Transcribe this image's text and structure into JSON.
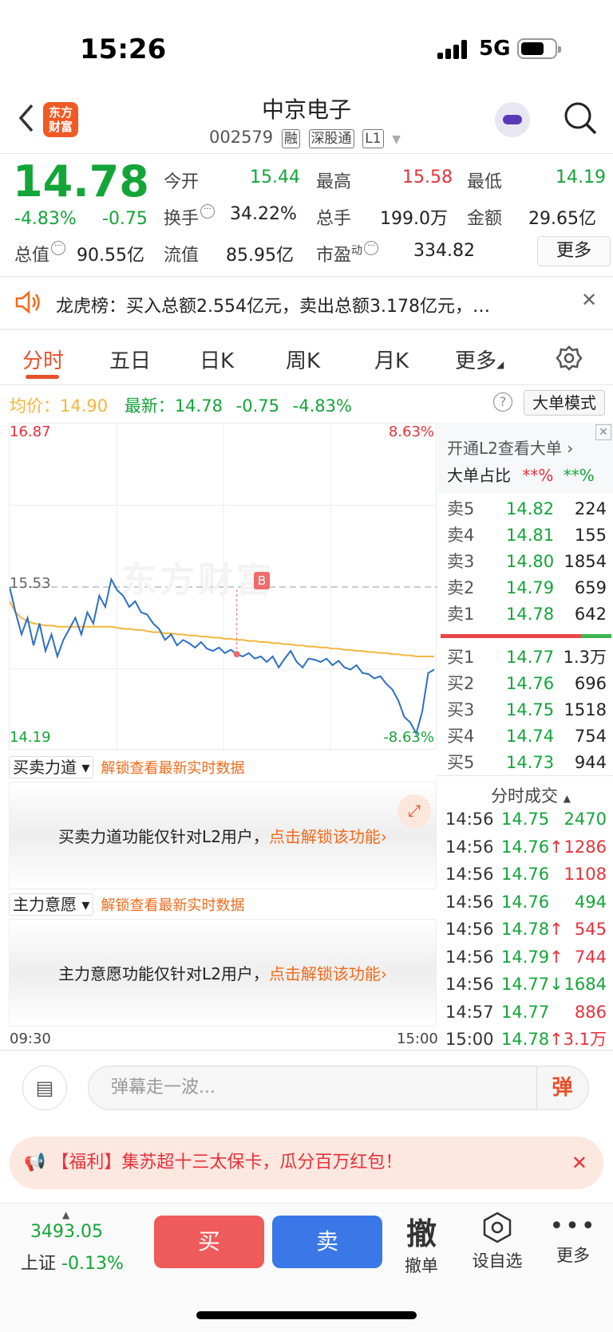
{
  "status": {
    "time": "15:26",
    "network": "5G"
  },
  "header": {
    "logo_text": "东方财富",
    "title": "中京电子",
    "code": "002579",
    "tags": [
      "融",
      "深股通",
      "L1"
    ]
  },
  "quote": {
    "price": "14.78",
    "change_pct": "-4.83%",
    "change": "-0.75",
    "fields": [
      {
        "label": "今开",
        "value": "15.44",
        "color": "green"
      },
      {
        "label": "最高",
        "value": "15.58",
        "color": "red"
      },
      {
        "label": "最低",
        "value": "14.19",
        "color": "green"
      },
      {
        "label": "换手",
        "value": "34.22%",
        "color": "dark"
      },
      {
        "label": "总手",
        "value": "199.0万",
        "color": "dark"
      },
      {
        "label": "金额",
        "value": "29.65亿",
        "color": "dark"
      },
      {
        "label": "总值",
        "value": "90.55亿",
        "color": "dark"
      },
      {
        "label": "流值",
        "value": "85.95亿",
        "color": "dark"
      },
      {
        "label": "市盈",
        "value": "334.82",
        "color": "dark"
      }
    ],
    "pe_sup": "动",
    "more_label": "更多"
  },
  "banner": {
    "text": "龙虎榜：买入总额2.554亿元，卖出总额3.178亿元，…"
  },
  "tabs": {
    "items": [
      "分时",
      "五日",
      "日K",
      "周K",
      "月K",
      "更多"
    ]
  },
  "info_bar": {
    "avg_label": "均价：",
    "avg_value": "14.90",
    "latest_label": "最新：",
    "latest_value": "14.78",
    "change": "-0.75",
    "change_pct": "-4.83%",
    "mode_label": "大单模式"
  },
  "chart_data": {
    "type": "line",
    "y_labels": {
      "top": "16.87",
      "mid": "15.53",
      "bottom": "14.19",
      "top_pct": "8.63%",
      "bottom_pct": "-8.63%"
    },
    "x_labels": {
      "start": "09:30",
      "end": "15:00"
    },
    "ylim": [
      14.19,
      16.87
    ],
    "prev_close": 15.53,
    "marker": "B",
    "watermark": "东方财富",
    "series": [
      {
        "name": "price",
        "color": "#2d6fc4",
        "values": [
          15.53,
          15.3,
          15.1,
          15.25,
          15.0,
          15.2,
          14.95,
          15.1,
          14.9,
          15.05,
          15.15,
          15.25,
          15.1,
          15.3,
          15.2,
          15.45,
          15.35,
          15.6,
          15.5,
          15.45,
          15.35,
          15.4,
          15.3,
          15.28,
          15.2,
          15.15,
          15.05,
          15.1,
          15.0,
          15.05,
          15.02,
          14.98,
          15.03,
          14.97,
          14.95,
          14.98,
          14.93,
          14.96,
          14.92,
          14.9,
          14.93,
          14.88,
          14.9,
          14.85,
          14.9,
          14.8,
          14.88,
          14.95,
          14.85,
          14.8,
          14.88,
          14.87,
          14.85,
          14.88,
          14.82,
          14.86,
          14.8,
          14.78,
          14.82,
          14.75,
          14.74,
          14.7,
          14.72,
          14.65,
          14.6,
          14.5,
          14.35,
          14.3,
          14.2,
          14.4,
          14.75,
          14.78
        ]
      },
      {
        "name": "avg",
        "color": "#f4b63d",
        "values": [
          15.4,
          15.3,
          15.25,
          15.22,
          15.2,
          15.19,
          15.18,
          15.18,
          15.17,
          15.17,
          15.17,
          15.17,
          15.17,
          15.17,
          15.17,
          15.17,
          15.17,
          15.17,
          15.16,
          15.15,
          15.15,
          15.14,
          15.14,
          15.13,
          15.12,
          15.12,
          15.11,
          15.11,
          15.1,
          15.1,
          15.09,
          15.09,
          15.08,
          15.08,
          15.07,
          15.07,
          15.06,
          15.06,
          15.05,
          15.05,
          15.04,
          15.04,
          15.03,
          15.03,
          15.02,
          15.02,
          15.01,
          15.01,
          15.0,
          15.0,
          14.99,
          14.99,
          14.98,
          14.98,
          14.97,
          14.97,
          14.96,
          14.96,
          14.95,
          14.95,
          14.94,
          14.94,
          14.93,
          14.93,
          14.92,
          14.92,
          14.91,
          14.91,
          14.9,
          14.9,
          14.9,
          14.9
        ]
      }
    ]
  },
  "l2": {
    "promo": "开通L2查看大单",
    "ratio_label": "大单占比",
    "ratio_red": "**%",
    "ratio_green": "**%"
  },
  "order_book": {
    "asks": [
      {
        "label": "卖5",
        "price": "14.82",
        "vol": "224"
      },
      {
        "label": "卖4",
        "price": "14.81",
        "vol": "155"
      },
      {
        "label": "卖3",
        "price": "14.80",
        "vol": "1854"
      },
      {
        "label": "卖2",
        "price": "14.79",
        "vol": "659"
      },
      {
        "label": "卖1",
        "price": "14.78",
        "vol": "642"
      }
    ],
    "bids": [
      {
        "label": "买1",
        "price": "14.77",
        "vol": "1.3万"
      },
      {
        "label": "买2",
        "price": "14.76",
        "vol": "696"
      },
      {
        "label": "买3",
        "price": "14.75",
        "vol": "1518"
      },
      {
        "label": "买4",
        "price": "14.74",
        "vol": "754"
      },
      {
        "label": "买5",
        "price": "14.73",
        "vol": "944"
      }
    ]
  },
  "ticks": {
    "title": "分时成交",
    "rows": [
      {
        "t": "14:56",
        "p": "14.75",
        "a": "",
        "v": "2470",
        "vc": "g"
      },
      {
        "t": "14:56",
        "p": "14.76",
        "a": "↑",
        "v": "1286",
        "vc": "r"
      },
      {
        "t": "14:56",
        "p": "14.76",
        "a": "",
        "v": "1108",
        "vc": "r"
      },
      {
        "t": "14:56",
        "p": "14.76",
        "a": "",
        "v": "494",
        "vc": "g"
      },
      {
        "t": "14:56",
        "p": "14.78",
        "a": "↑",
        "v": "545",
        "vc": "r"
      },
      {
        "t": "14:56",
        "p": "14.79",
        "a": "↑",
        "v": "744",
        "vc": "r"
      },
      {
        "t": "14:56",
        "p": "14.77",
        "a": "↓",
        "v": "1684",
        "vc": "g"
      },
      {
        "t": "14:57",
        "p": "14.77",
        "a": "",
        "v": "886",
        "vc": "r"
      },
      {
        "t": "15:00",
        "p": "14.78",
        "a": "↑",
        "v": "3.1万",
        "vc": "r"
      }
    ]
  },
  "panels": {
    "p1_label": "买卖力道",
    "p1_unlock": "解锁查看最新实时数据",
    "p1_text": "买卖力道功能仅针对L2用户，",
    "p1_link": "点击解锁该功能",
    "p2_label": "主力意愿",
    "p2_unlock": "解锁查看最新实时数据",
    "p2_text": "主力意愿功能仅针对L2用户，",
    "p2_link": "点击解锁该功能"
  },
  "danmu": {
    "placeholder": "弹幕走一波...",
    "btn": "弹"
  },
  "promo": {
    "text": "【福利】集苏超十三太保卡，瓜分百万红包！"
  },
  "footer": {
    "index_value": "3493.05",
    "index_name": "上证",
    "index_change": "-0.13%",
    "buy": "买",
    "sell": "卖",
    "cancel_icon": "撤",
    "cancel": "撤单",
    "watch": "设自选",
    "more": "更多"
  }
}
